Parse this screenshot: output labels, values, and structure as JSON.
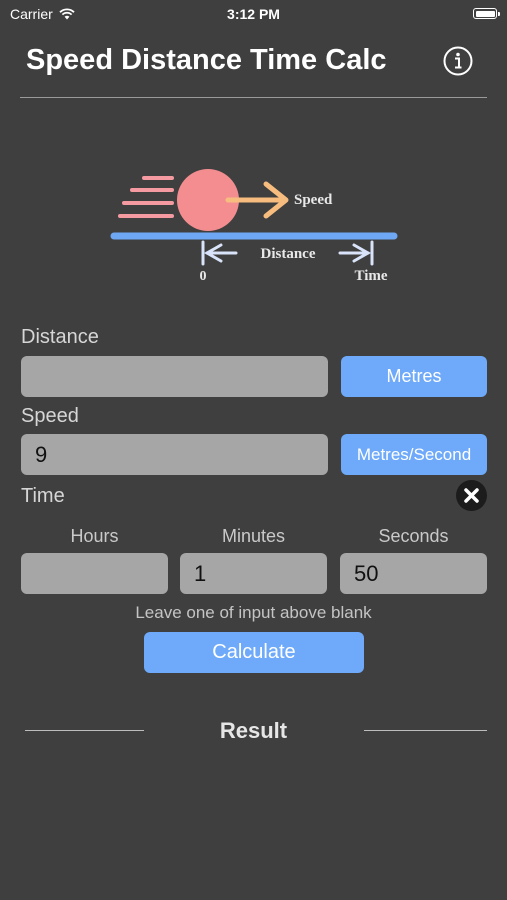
{
  "status_bar": {
    "carrier": "Carrier",
    "time": "3:12 PM"
  },
  "header": {
    "title": "Speed Distance Time Calc"
  },
  "diagram": {
    "speed_label": "Speed",
    "distance_label": "Distance",
    "zero_label": "0",
    "time_label": "Time"
  },
  "distance": {
    "label": "Distance",
    "value": "",
    "unit_button": "Metres"
  },
  "speed": {
    "label": "Speed",
    "value": "9",
    "unit_button": "Metres/Second"
  },
  "time": {
    "label": "Time",
    "hours_label": "Hours",
    "hours_value": "",
    "minutes_label": "Minutes",
    "minutes_value": "1",
    "seconds_label": "Seconds",
    "seconds_value": "50"
  },
  "hint": "Leave one of input above blank",
  "calculate_button": "Calculate",
  "result_label": "Result",
  "colors": {
    "background": "#3f3f3f",
    "accent": "#6eaaf9",
    "field": "#a6a6a6"
  }
}
